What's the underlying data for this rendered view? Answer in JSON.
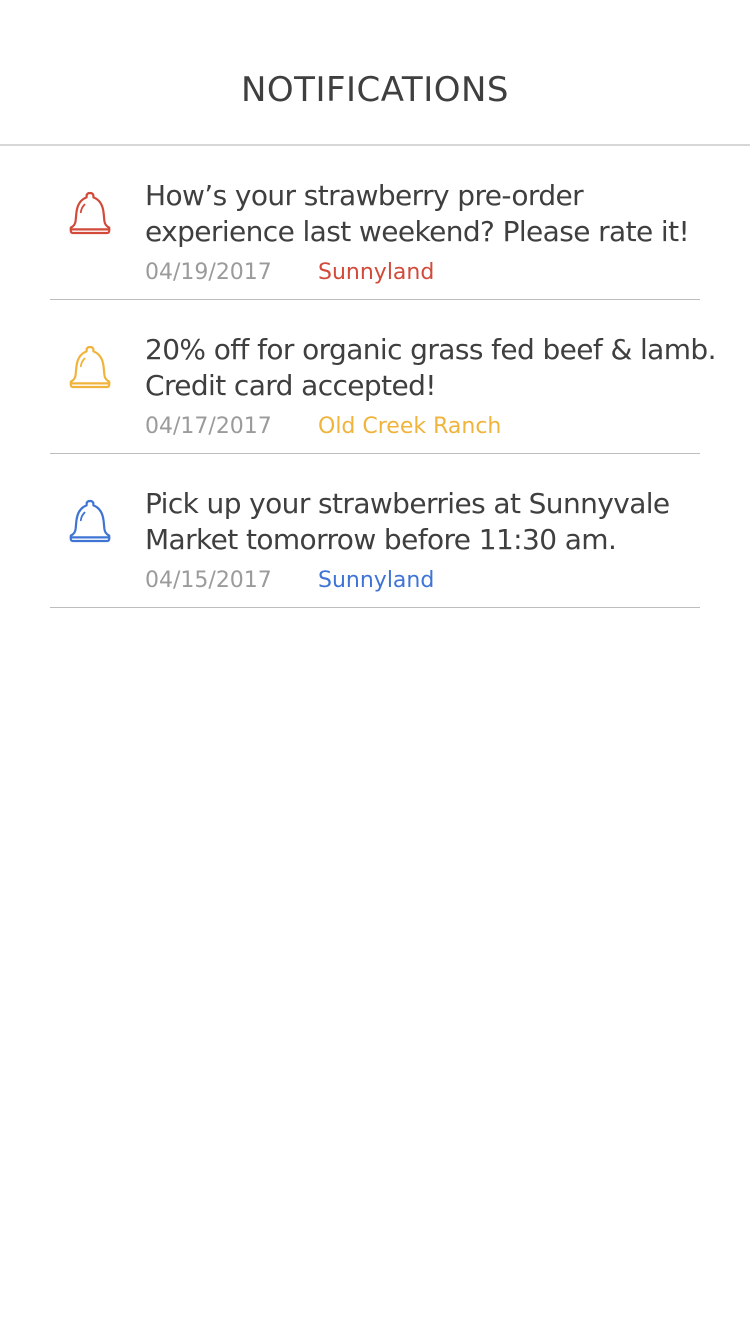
{
  "header": {
    "title": "NOTIFICATIONS"
  },
  "notifications": [
    {
      "message_line1": "How’s your strawberry pre-order",
      "message_line2": "experience last weekend? Please rate it!",
      "date": "04/19/2017",
      "source": "Sunnyland",
      "accent_color": "#d24a3a",
      "icon": "bell-icon"
    },
    {
      "message_line1": "20% off for organic grass fed beef & lamb.",
      "message_line2": "Credit card accepted!",
      "date": "04/17/2017",
      "source": "Old Creek Ranch",
      "accent_color": "#f0b43c",
      "icon": "bell-icon"
    },
    {
      "message_line1": "Pick up your strawberries at Sunnyvale",
      "message_line2": "Market tomorrow before 11:30 am.",
      "date": "04/15/2017",
      "source": "Sunnyland",
      "accent_color": "#3f74d4",
      "icon": "bell-icon"
    }
  ]
}
